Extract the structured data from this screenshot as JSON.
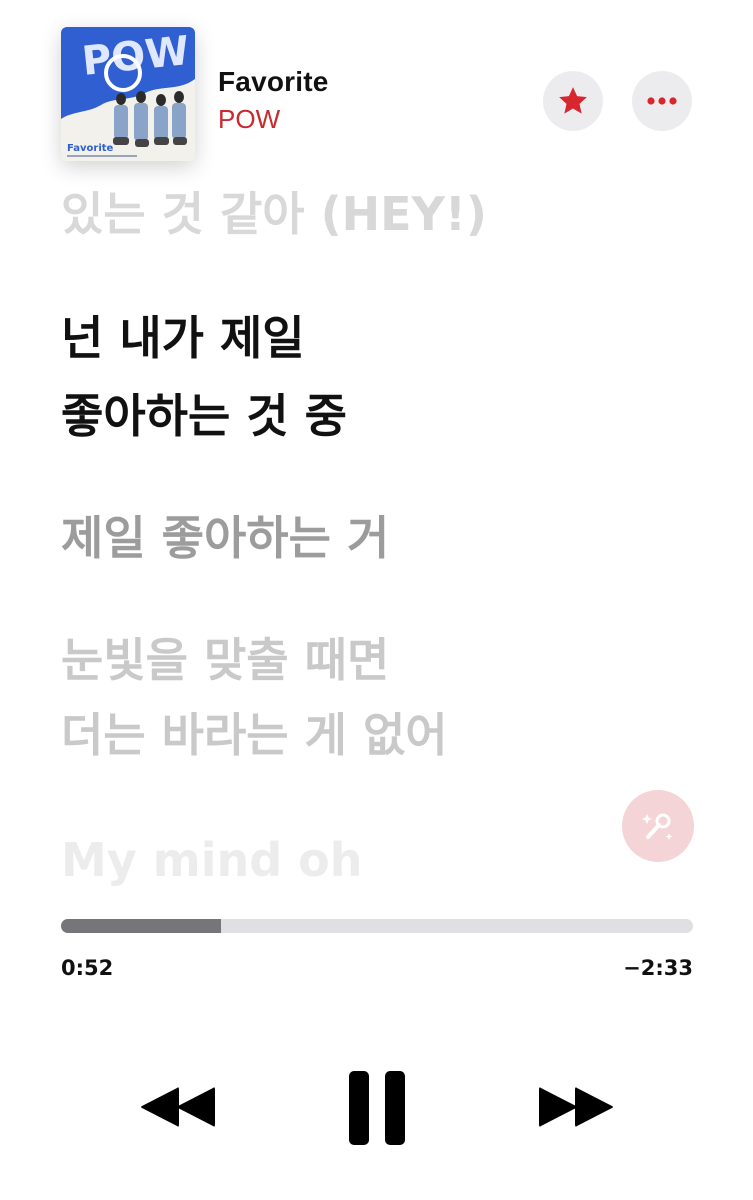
{
  "now_playing": {
    "title": "Favorite",
    "artist": "POW",
    "artwork": {
      "logo_text": "POW",
      "cover_title": "Favorite",
      "brand_color": "#2f5fd0"
    }
  },
  "header_buttons": {
    "favorite_icon": "star-icon",
    "favorite_color": "#d7262d",
    "more_icon": "ellipsis-icon",
    "more_color": "#d7262d"
  },
  "lyrics": [
    {
      "text": "있는 것 같아 (HEY!)",
      "state": "past"
    },
    {
      "text": "넌 내가 제일",
      "state": "current"
    },
    {
      "text": "좋아하는 것 중",
      "state": "current"
    },
    {
      "text": "제일 좋아하는 거",
      "state": "next"
    },
    {
      "text": "눈빛을 맞출 때면",
      "state": "upcoming"
    },
    {
      "text": "더는 바라는 게 없어",
      "state": "upcoming"
    },
    {
      "text": "My mind oh",
      "state": "upcoming"
    }
  ],
  "sing_button_icon": "microphone-sparkle-icon",
  "playback": {
    "elapsed": "0:52",
    "remaining": "−2:33",
    "progress": 0.253
  },
  "controls": {
    "rewind_icon": "rewind-icon",
    "pause_icon": "pause-icon",
    "forward_icon": "fast-forward-icon"
  }
}
